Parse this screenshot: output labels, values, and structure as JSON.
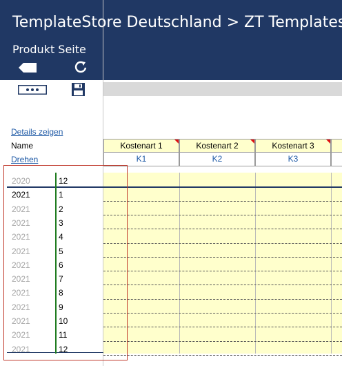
{
  "header": {
    "title": "TemplateStore Deutschland > ZT  Templates",
    "subtitle": "Produkt Seite",
    "icons": [
      "back-icon",
      "refresh-icon",
      "more-icon",
      "save-icon"
    ]
  },
  "links": {
    "details": "Details zeigen",
    "rotate": "Drehen"
  },
  "labels": {
    "name": "Name"
  },
  "columns": [
    {
      "name": "Kostenart 1",
      "code": "K1"
    },
    {
      "name": "Kostenart 2",
      "code": "K2"
    },
    {
      "name": "Kostenart 3",
      "code": "K3"
    }
  ],
  "rows": [
    {
      "year": "2020",
      "month": "12",
      "active": false
    },
    {
      "year": "2021",
      "month": "1",
      "active": true
    },
    {
      "year": "2021",
      "month": "2",
      "active": false
    },
    {
      "year": "2021",
      "month": "3",
      "active": false
    },
    {
      "year": "2021",
      "month": "4",
      "active": false
    },
    {
      "year": "2021",
      "month": "5",
      "active": false
    },
    {
      "year": "2021",
      "month": "6",
      "active": false
    },
    {
      "year": "2021",
      "month": "7",
      "active": false
    },
    {
      "year": "2021",
      "month": "8",
      "active": false
    },
    {
      "year": "2021",
      "month": "9",
      "active": false
    },
    {
      "year": "2021",
      "month": "10",
      "active": false
    },
    {
      "year": "2021",
      "month": "11",
      "active": false
    },
    {
      "year": "2021",
      "month": "12",
      "active": false
    }
  ],
  "colors": {
    "header_bg": "#203864",
    "cell_yellow": "#ffffcc",
    "link_blue": "#1f5aa6",
    "highlight_red": "#c0392b",
    "divider_green": "#1e7b1e",
    "muted_year": "#a6a6a6"
  }
}
